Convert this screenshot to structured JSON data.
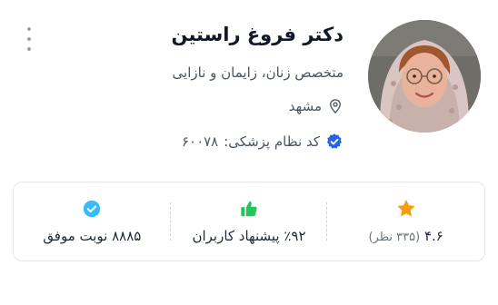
{
  "doctor": {
    "name": "دکتر فروغ راستین",
    "specialty": "متخصص زنان، زایمان و نازایی",
    "city": "مشهد",
    "license_label": "کد نظام پزشکی:",
    "license_number": "۶۰۰۷۸"
  },
  "stats": {
    "rating": {
      "icon": "star-icon",
      "value": "۴.۶",
      "reviews": "(۳۳۵ نظر)",
      "color": "#f59e0b"
    },
    "recommendation": {
      "icon": "thumbs-up-icon",
      "value": "٪۹۲ پیشنهاد کاربران",
      "color": "#22c55e"
    },
    "appointments": {
      "icon": "check-circle-icon",
      "value": "۸۸۸۵ نوبت موفق",
      "color": "#38bdf8"
    }
  },
  "colors": {
    "verified_badge": "#2563eb",
    "text_primary": "#111827",
    "text_secondary": "#4b5563"
  }
}
